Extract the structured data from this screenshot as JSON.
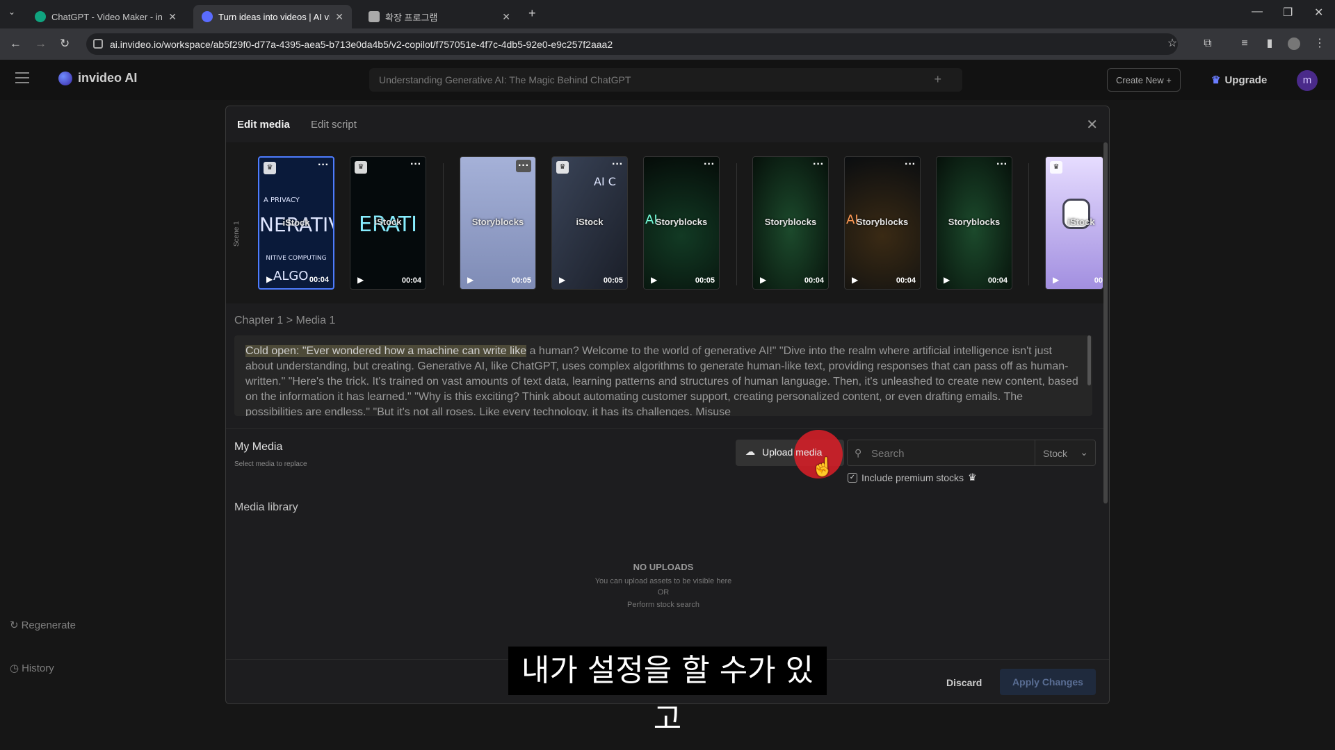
{
  "browser": {
    "tabs": [
      {
        "title": "ChatGPT - Video Maker - invi",
        "favicon_color": "#10a37f"
      },
      {
        "title": "Turn ideas into videos | AI vide",
        "favicon_color": "#5a6cff"
      },
      {
        "title": "확장 프로그램",
        "favicon_color": "#aaaaaa"
      }
    ],
    "new_tab": "+",
    "url": "ai.invideo.io/workspace/ab5f29f0-d77a-4395-aea5-b713e0da4b5/v2-copilot/f757051e-4f7c-4db5-92e0-e9c257f2aaa2"
  },
  "app": {
    "logo_text": "invideo AI",
    "project_title": "Understanding Generative AI: The Magic Behind ChatGPT",
    "create_new": "Create New",
    "upgrade": "Upgrade",
    "avatar_initial": "m",
    "sidebar": {
      "regenerate": "Regenerate",
      "history": "History"
    }
  },
  "modal": {
    "tabs": [
      "Edit media",
      "Edit script"
    ],
    "scene_label": "Scene 1",
    "thumbnails": [
      {
        "source": "iStock",
        "duration": "00:04",
        "premium": true,
        "selected": true,
        "bg": "#0a1a3a",
        "overlay": "NERATIV",
        "top_text": "A PRIVACY",
        "bottom_text": "NITIVE COMPUTING",
        "bottom_big": "ALGO"
      },
      {
        "source": "iStock",
        "duration": "00:04",
        "premium": true,
        "selected": false,
        "bg": "#050a0c",
        "overlay": "ERATI"
      },
      {
        "source": "Storyblocks",
        "duration": "00:05",
        "premium": false,
        "selected": false,
        "bg": "#8b98c0"
      },
      {
        "source": "iStock",
        "duration": "00:05",
        "premium": true,
        "selected": false,
        "bg": "#2a3040",
        "overlay": "AI C"
      },
      {
        "source": "Storyblocks",
        "duration": "00:05",
        "premium": false,
        "selected": false,
        "bg": "#0a120e",
        "overlay": "AI"
      },
      {
        "source": "Storyblocks",
        "duration": "00:04",
        "premium": false,
        "selected": false,
        "bg": "#07110c"
      },
      {
        "source": "Storyblocks",
        "duration": "00:04",
        "premium": false,
        "selected": false,
        "bg": "#0a0d10",
        "overlay": "AI"
      },
      {
        "source": "Storyblocks",
        "duration": "00:04",
        "premium": false,
        "selected": false,
        "bg": "#07110c"
      },
      {
        "source": "iStock",
        "duration": "00",
        "premium": true,
        "selected": false,
        "bg": "#b9a8e6"
      }
    ],
    "breadcrumb": "Chapter 1 > Media 1",
    "script_highlight": "Cold open: \"Ever wondered how a machine can write like",
    "script_rest": " a human? Welcome to the world of generative AI!\" \"Dive into the realm where artificial intelligence isn't just about understanding, but creating. Generative AI, like ChatGPT, uses complex algorithms to generate human-like text, providing responses that can pass off as human-written.\" \"Here's the trick. It's trained on vast amounts of text data, learning patterns and structures of human language. Then, it's unleashed to create new content, based on the information it has learned.\" \"Why is this exciting? Think about automating customer support, creating personalized content, or even drafting emails. The possibilities are endless.\" \"But it's not all roses. Like every technology, it has its challenges. Misuse",
    "my_media": {
      "title": "My Media",
      "subtitle": "Select media to replace"
    },
    "upload_button": "Upload media",
    "search": {
      "placeholder": "Search",
      "source": "Stock"
    },
    "include_premium": "Include premium stocks",
    "media_library": "Media library",
    "no_uploads": {
      "title": "NO UPLOADS",
      "line1": "You can upload assets to be visible here",
      "or": "OR",
      "line2": "Perform stock search"
    },
    "discard": "Discard",
    "apply": "Apply Changes"
  },
  "video_subtitle": "내가 설정을 할 수가 있고"
}
